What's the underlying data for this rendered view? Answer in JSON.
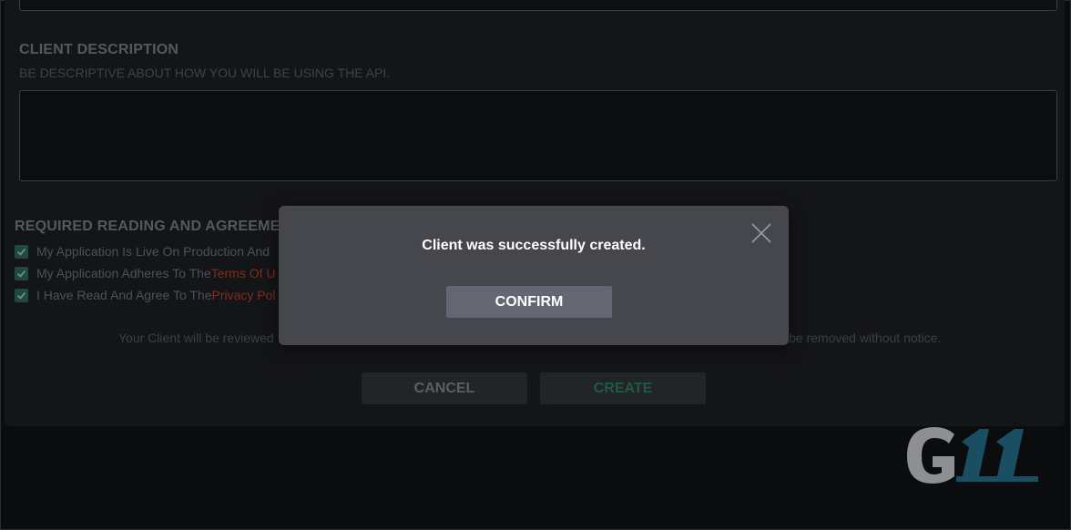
{
  "client_description": {
    "label": "CLIENT DESCRIPTION",
    "hint": "BE DESCRIPTIVE ABOUT HOW YOU WILL BE USING THE API.",
    "value": ""
  },
  "agreements": {
    "heading": "REQUIRED READING AND AGREEMENTS",
    "items": [
      {
        "text": "My Application Is Live On Production And",
        "link": "",
        "checked": true
      },
      {
        "text": "My Application Adheres To The ",
        "link": "Terms Of U",
        "checked": true
      },
      {
        "text": "I Have Read And Agree To The ",
        "link": "Privacy Pol",
        "checked": true
      }
    ]
  },
  "review_note": {
    "left": "Your Client will be reviewed",
    "right": "be removed without notice."
  },
  "buttons": {
    "cancel": "CANCEL",
    "create": "CREATE"
  },
  "modal": {
    "message": "Client was successfully created.",
    "confirm": "CONFIRM",
    "close_icon": "close-icon"
  },
  "logo": {
    "text": "G11"
  },
  "colors": {
    "background": "#0b0c0d",
    "panel": "#141518",
    "modal": "#45474d",
    "confirm_button": "#646771",
    "link": "#7a2f1f",
    "create_text": "#1f5a44",
    "checkbox": "#1f4a3d",
    "logo_teal": "#1a4f63"
  }
}
